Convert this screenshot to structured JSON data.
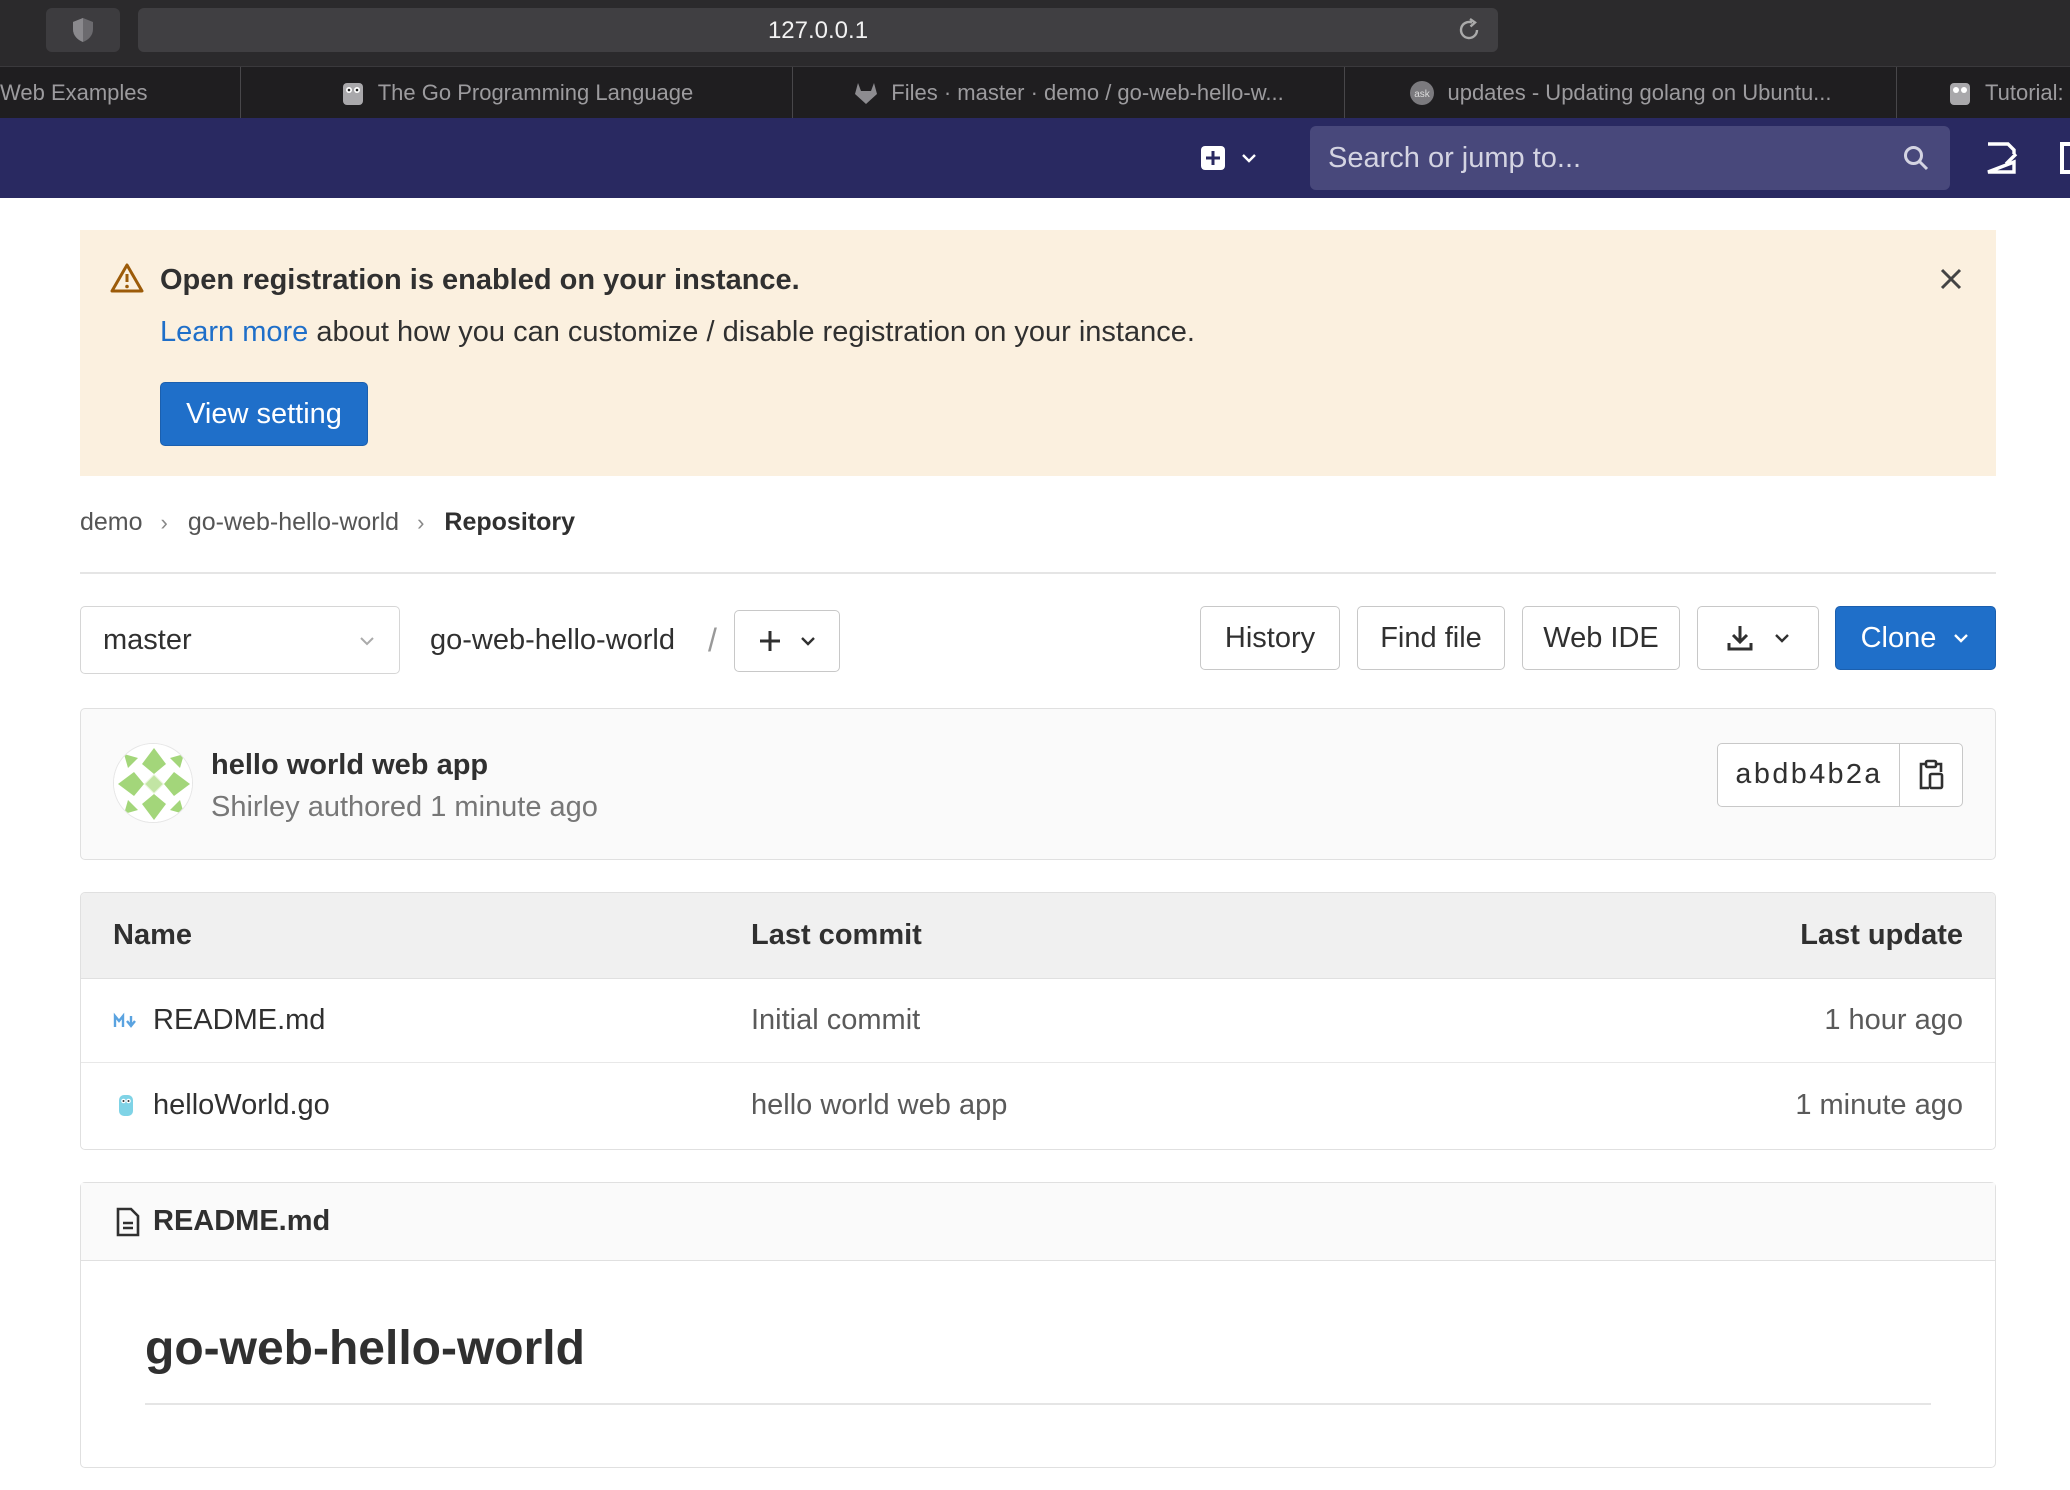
{
  "browser": {
    "url": "127.0.0.1",
    "tabs": [
      {
        "label": "Web Examples",
        "icon": "none"
      },
      {
        "label": "The Go Programming Language",
        "icon": "gopher-icon"
      },
      {
        "label": "Files · master · demo / go-web-hello-w...",
        "icon": "gitlab-icon"
      },
      {
        "label": "updates - Updating golang on Ubuntu...",
        "icon": "askubuntu-icon"
      },
      {
        "label": "Tutorial:",
        "icon": "gopher-icon"
      }
    ]
  },
  "nav": {
    "search_placeholder": "Search or jump to...",
    "bg_color": "#292961"
  },
  "alert": {
    "title": "Open registration is enabled on your instance.",
    "link": "Learn more",
    "body": "about how you can customize / disable registration on your instance.",
    "button": "View setting"
  },
  "breadcrumb": {
    "items": [
      "demo",
      "go-web-hello-world"
    ],
    "current": "Repository"
  },
  "toolbar": {
    "branch": "master",
    "path": "go-web-hello-world",
    "path_sep": "/",
    "history": "History",
    "find_file": "Find file",
    "web_ide": "Web IDE",
    "clone": "Clone"
  },
  "commit": {
    "title": "hello world web app",
    "meta": "Shirley authored 1 minute ago",
    "sha": "abdb4b2a"
  },
  "files": {
    "headers": {
      "name": "Name",
      "last_commit": "Last commit",
      "last_update": "Last update"
    },
    "rows": [
      {
        "name": "README.md",
        "icon": "markdown-icon",
        "last_commit": "Initial commit",
        "last_update": "1 hour ago"
      },
      {
        "name": "helloWorld.go",
        "icon": "go-file-icon",
        "last_commit": "hello world web app",
        "last_update": "1 minute ago"
      }
    ]
  },
  "readme": {
    "filename": "README.md",
    "heading": "go-web-hello-world"
  },
  "colors": {
    "primary": "#1f6fc9",
    "alert_bg": "#fbf0df",
    "warning": "#c17d10"
  }
}
